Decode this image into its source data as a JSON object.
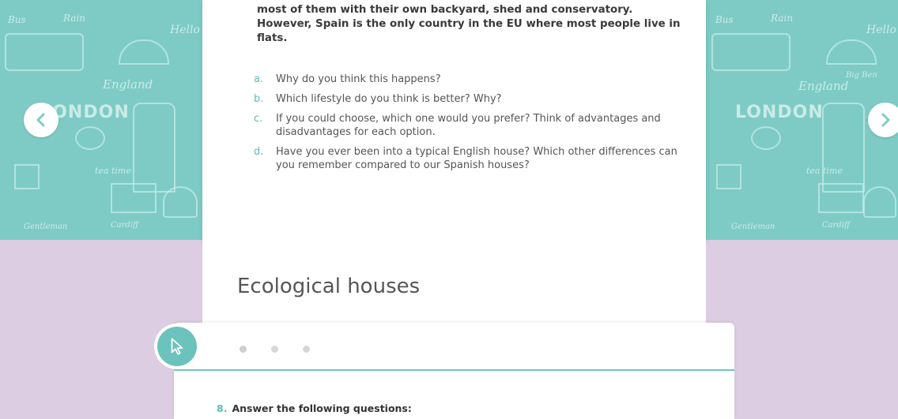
{
  "intro_text": "most of them with their own backyard, shed and conservatory. However, Spain is the only country in the EU where most people live in flats.",
  "questions": [
    {
      "letter": "a.",
      "text": "Why do you think this happens?"
    },
    {
      "letter": "b.",
      "text": "Which lifestyle do you think is better? Why?"
    },
    {
      "letter": "c.",
      "text": "If you could choose, which one would you prefer? Think of advantages and disadvantages for each option."
    },
    {
      "letter": "d.",
      "text": "Have you ever been into a typical English house? Which other differences can you remember compared to our Spanish houses?"
    }
  ],
  "section_title": "Ecological houses",
  "task": {
    "number": "8.",
    "text": "Answer the following questions:"
  },
  "background_doodles": {
    "left": [
      "Bus",
      "Rain",
      "Hello",
      "England",
      "LONDON",
      "tea time",
      "Gentleman",
      "Cardiff"
    ],
    "right": [
      "Bus",
      "Rain",
      "Hello",
      "England",
      "LONDON",
      "tea time",
      "Gentleman",
      "Cardiff",
      "Big Ben"
    ]
  },
  "colors": {
    "teal": "#7ecbc5",
    "lilac": "#dccde3",
    "accent": "#5dbdb6"
  },
  "icons": {
    "prev": "chevron-left-icon",
    "next": "chevron-right-icon",
    "pointer": "cursor-icon"
  }
}
